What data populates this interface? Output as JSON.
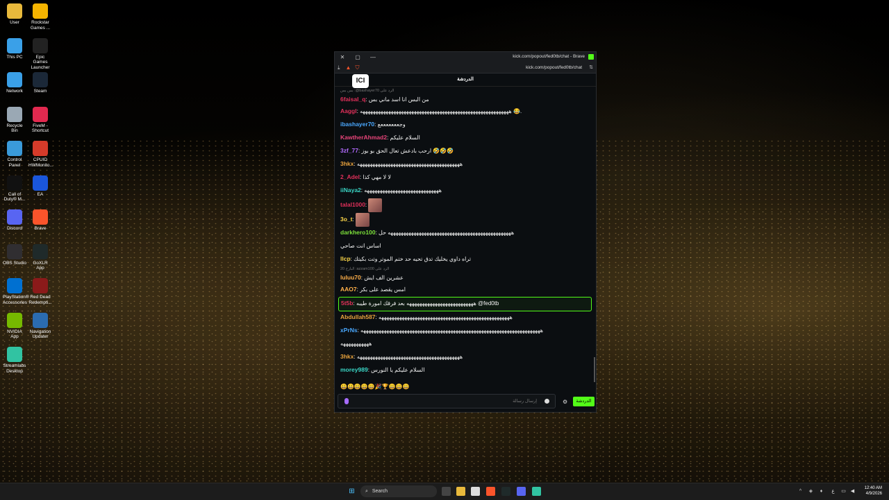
{
  "desktop_icons": [
    {
      "label": "User",
      "color": "#e8b93c"
    },
    {
      "label": "Rockstar Games ...",
      "color": "#f5b400"
    },
    {
      "label": "This PC",
      "color": "#3aa0e8"
    },
    {
      "label": "Epic Games Launcher",
      "color": "#222222"
    },
    {
      "label": "Network",
      "color": "#3aa0e8"
    },
    {
      "label": "Steam",
      "color": "#1b2838"
    },
    {
      "label": "Recycle Bin",
      "color": "#9aa8b4"
    },
    {
      "label": "FiveM - Shortcut",
      "color": "#e2294f"
    },
    {
      "label": "Control Panel",
      "color": "#3a9ad9"
    },
    {
      "label": "CPUID HWMonito...",
      "color": "#d63b2a"
    },
    {
      "label": "Call of Duty® M...",
      "color": "#111111"
    },
    {
      "label": "EA",
      "color": "#1a56db"
    },
    {
      "label": "Discord",
      "color": "#5865f2"
    },
    {
      "label": "Brave",
      "color": "#fb542b"
    },
    {
      "label": "OBS Studio",
      "color": "#302e31"
    },
    {
      "label": "GoXLR App",
      "color": "#1f2a2a"
    },
    {
      "label": "PlayStation® Accessories",
      "color": "#0070d1"
    },
    {
      "label": "Red Dead Redempti...",
      "color": "#8b1a1a"
    },
    {
      "label": "NVIDIA App",
      "color": "#76b900"
    },
    {
      "label": "Navigation Updater",
      "color": "#2b6cb0"
    },
    {
      "label": "Streamlabs Desktop",
      "color": "#31c3a2"
    }
  ],
  "window": {
    "title": "kick.com/popout/fed0tb/chat - Brave",
    "url": "kick.com/popout/fed0tb/chat",
    "chat_header": "الدردشة",
    "avatar_text": "ICI"
  },
  "messages": [
    {
      "reply": "بس بس :@bashayer70 الرد على",
      "user": "6faisal_q",
      "color": "#e0305a",
      "text": "من البس انا اسد ماني بس"
    },
    {
      "user": "Aaggl",
      "color": "#e0305a",
      "text": "ههههههههههههههههههههههههههههههههههههههههههههههههههههههههههه 😂."
    },
    {
      "user": "ibashayer70",
      "color": "#4aa8ff",
      "text": "وجعععععععع"
    },
    {
      "user": "KawtherAhmad2",
      "color": "#e8457a",
      "text": "السلام عليكم"
    },
    {
      "user": "3zf_77",
      "color": "#b36bff",
      "text": "ارحب بادعش تعال الحق بو بوز 🤣🤣🤣"
    },
    {
      "user": "3hkx",
      "color": "#e8a23c",
      "text": "ههههههههههههههههههههههههههههههههههههههههه"
    },
    {
      "user": "2_Adel",
      "color": "#e0305a",
      "text": "لا لا مهي كذا"
    },
    {
      "user": "iiNaya2",
      "color": "#3ad6c6",
      "text": "هههههههههههههههههههههههههههههه"
    },
    {
      "user": "talal1000",
      "color": "#e0305a",
      "text": ""
    },
    {
      "user": "3o_t",
      "color": "#ffd84a",
      "text": ""
    },
    {
      "user": "darkhero100",
      "color": "#7ce03a",
      "text": "ههههههههههههههههههههههههههههههههههههههههههههههههه حل"
    },
    {
      "user": "",
      "color": "#ffffff",
      "text": "اساس انت صاحي"
    },
    {
      "user": "llcp",
      "color": "#ffd84a",
      "text": "تراه داوي يخليك تدق تحيه حد ختم الموتر وتت بكيتك"
    },
    {
      "reply": "البارح 20 :azzam100 الرد على",
      "user": "luluu70",
      "color": "#ffb04a",
      "text": "عشرين الف ايش"
    },
    {
      "user": "AAO7",
      "color": "#ffb04a",
      "text": "امس يقصد على بكر"
    },
    {
      "user": "5t5b",
      "color": "#e0305a",
      "text": "ههههههههههههههههههههههههههه بعد فرقك امورة طيبه @fed0tb",
      "highlight": true
    },
    {
      "user": "Abdullah587",
      "color": "#e8a23c",
      "text": "هههههههههههههههههههههههههههههههههههههههههههههههههههه"
    },
    {
      "user": "xPrNs",
      "color": "#4aa8ff",
      "text": "ههههههههههههههههههههههههههههههههههههههههههههههههههههههههههههههههههههههه"
    },
    {
      "user": "",
      "color": "#ffffff",
      "text": "هههههههههههه"
    },
    {
      "user": "3hkx",
      "color": "#e8a23c",
      "text": "ههههههههههههههههههههههههههههههههههههههههه"
    },
    {
      "user": "morey989",
      "color": "#3ad6c6",
      "text": "السلام عليكم يا النورس"
    }
  ],
  "emote_bar": "😀😀😀😀😀🎉🏆😀😀😀",
  "input": {
    "placeholder": "إرسال رسالة",
    "send_label": "الدردشة"
  },
  "taskbar": {
    "search": "Search",
    "lang": "ع",
    "time": "12:40 AM",
    "date": "4/9/2026"
  }
}
